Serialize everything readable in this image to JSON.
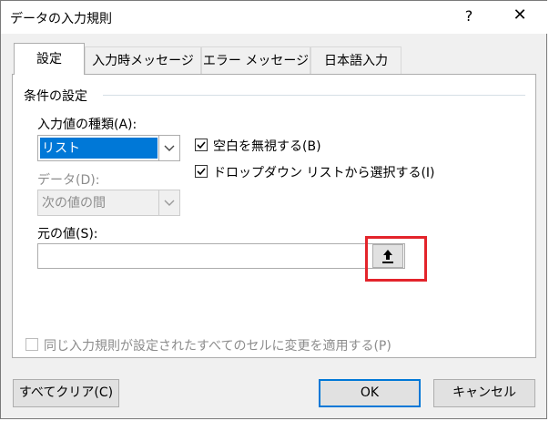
{
  "dialog": {
    "title": "データの入力規則",
    "help_label": "?",
    "close_label": "✕"
  },
  "tabs": [
    {
      "label": "設定",
      "active": true
    },
    {
      "label": "入力時メッセージ",
      "active": false
    },
    {
      "label": "エラー メッセージ",
      "active": false
    },
    {
      "label": "日本語入力",
      "active": false
    }
  ],
  "settings": {
    "group_label": "条件の設定",
    "allow_label": "入力値の種類(A):",
    "allow_value": "リスト",
    "data_label": "データ(D):",
    "data_value": "次の値の間",
    "ignore_blank_label": "空白を無視する(B)",
    "ignore_blank_checked": true,
    "in_cell_dropdown_label": "ドロップダウン リストから選択する(I)",
    "in_cell_dropdown_checked": true,
    "source_label": "元の値(S):",
    "source_value": "",
    "apply_all_label": "同じ入力規則が設定されたすべてのセルに変更を適用する(P)",
    "apply_all_checked": false
  },
  "footer": {
    "clear_all_label": "すべてクリア(C)",
    "ok_label": "OK",
    "cancel_label": "キャンセル"
  },
  "colors": {
    "accent": "#0078d7",
    "highlight": "#e3242b"
  }
}
